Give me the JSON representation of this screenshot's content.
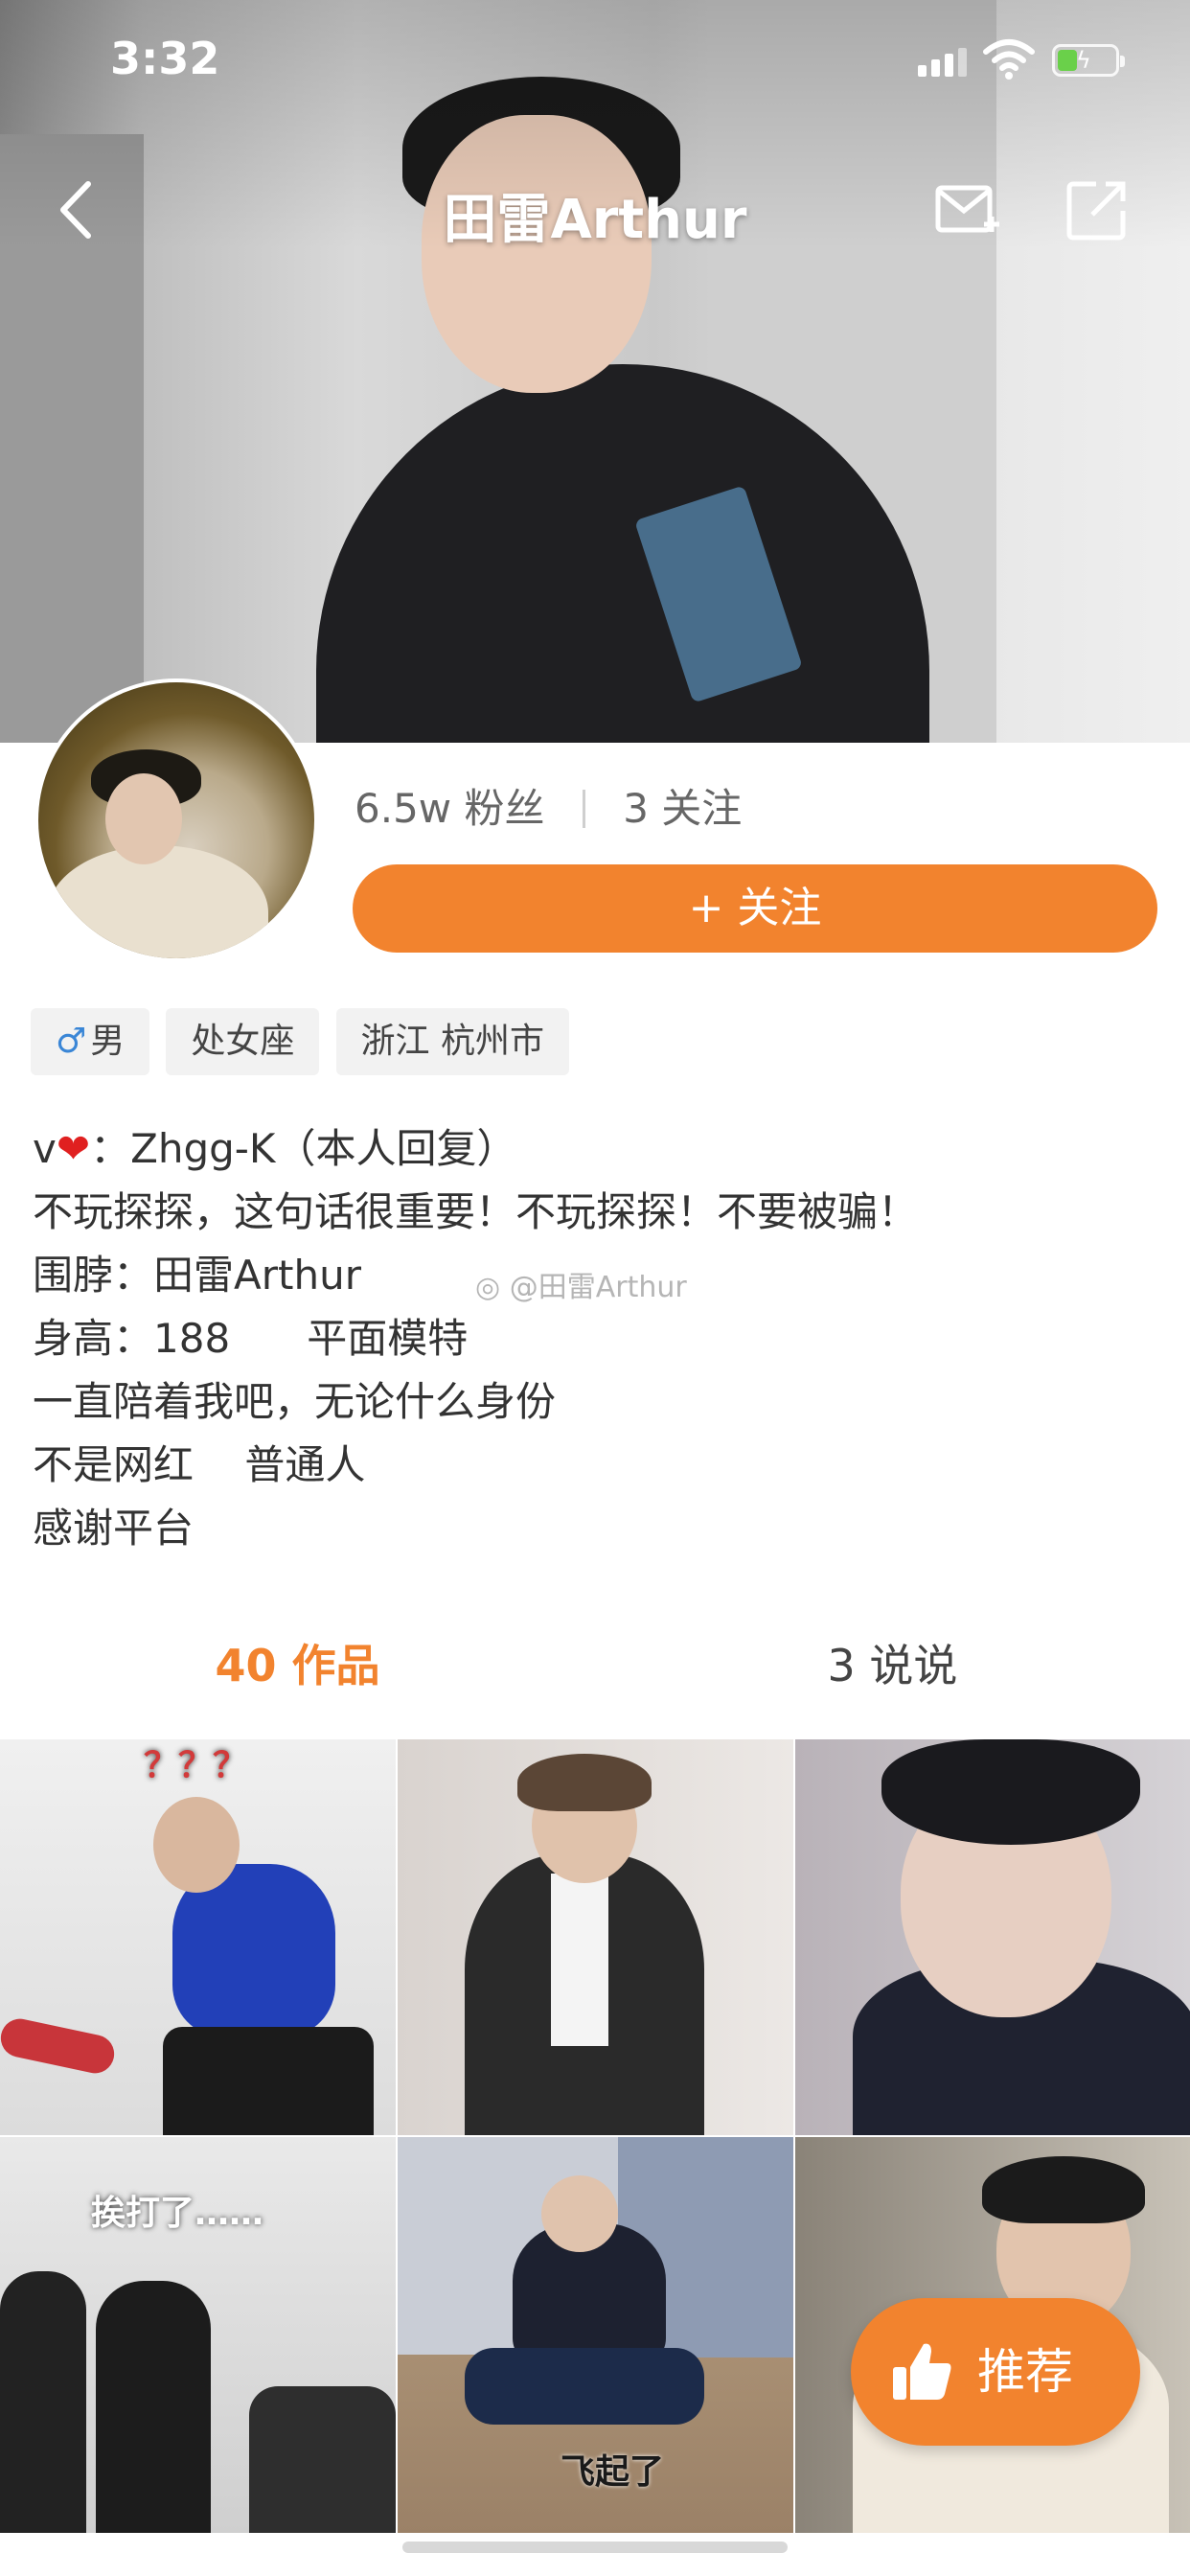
{
  "status_bar": {
    "time": "3:32"
  },
  "nav": {
    "title": "田雷Arthur"
  },
  "profile": {
    "fans": "6.5w 粉丝",
    "following": "3 关注",
    "follow_button": "+ 关注"
  },
  "tags": [
    {
      "icon": "♂",
      "label": "男"
    },
    {
      "label": "处女座"
    },
    {
      "label": "浙江 杭州市"
    }
  ],
  "bio": {
    "line1_prefix": "v",
    "line1_suffix": "：Zhgg-K（本人回复）",
    "line2": "不玩探探，这句话很重要！不玩探探！不要被骗！",
    "line3": "围脖：田雷Arthur",
    "line4": "身高：188      平面模特",
    "line5": "一直陪着我吧，无论什么身份",
    "line6": "不是网红    普通人",
    "line7": "感谢平台",
    "watermark": "@田雷Arthur"
  },
  "tabs": {
    "works": "40 作品",
    "posts": "3 说说"
  },
  "grid": {
    "captions": {
      "c1": "？？？",
      "c4": "挨打了……",
      "c5": "飞起了"
    }
  },
  "recommend": {
    "label": "推荐"
  },
  "colors": {
    "accent": "#f2832e"
  }
}
